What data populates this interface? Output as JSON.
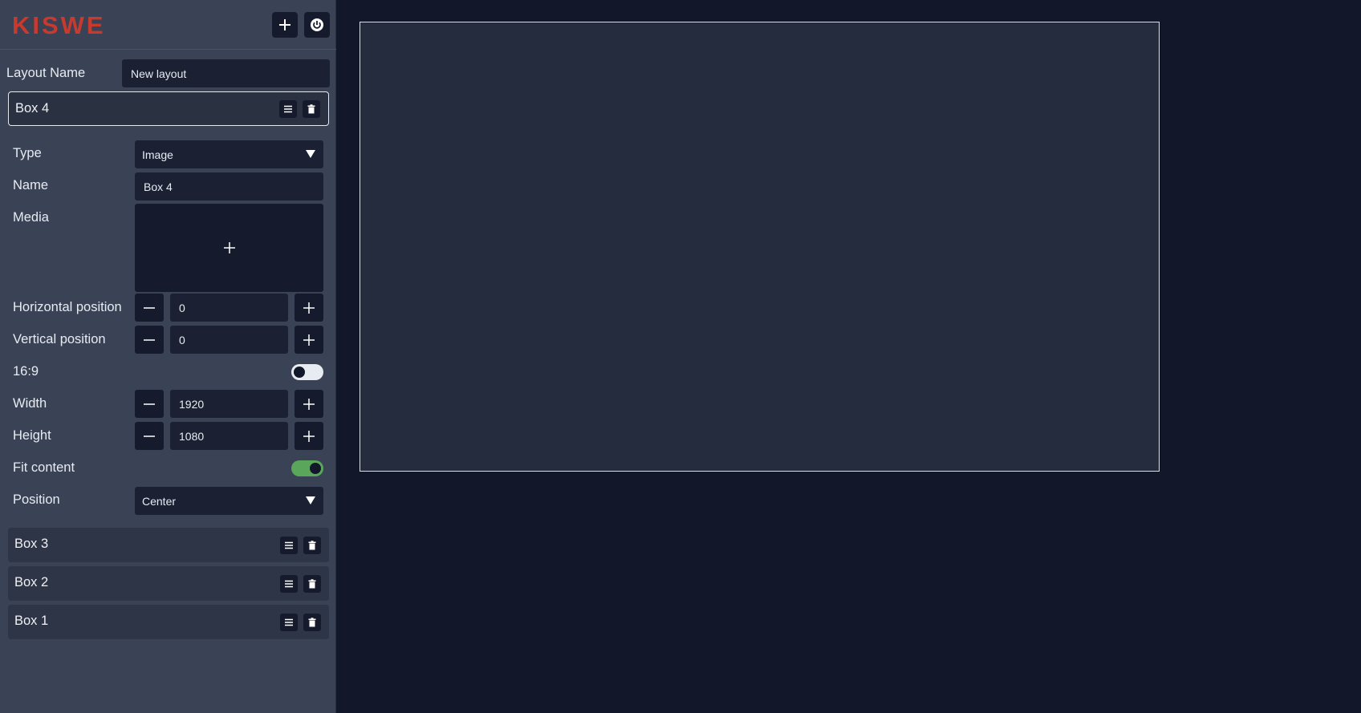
{
  "header": {
    "logo_text": "KISWE",
    "add_icon": "plus-icon",
    "power_icon": "power-icon"
  },
  "layout": {
    "name_label": "Layout Name",
    "name_value": "New layout"
  },
  "active_box": {
    "title": "Box 4",
    "fields": {
      "type_label": "Type",
      "type_value": "Image",
      "name_label": "Name",
      "name_value": "Box 4",
      "media_label": "Media",
      "hpos_label": "Horizontal position",
      "hpos_value": "0",
      "vpos_label": "Vertical position",
      "vpos_value": "0",
      "aspect_label": "16:9",
      "aspect_on": false,
      "width_label": "Width",
      "width_value": "1920",
      "height_label": "Height",
      "height_value": "1080",
      "fit_label": "Fit content",
      "fit_on": true,
      "position_label": "Position",
      "position_value": "Center"
    }
  },
  "boxes": [
    {
      "title": "Box 3"
    },
    {
      "title": "Box 2"
    },
    {
      "title": "Box 1"
    }
  ],
  "colors": {
    "accent_logo": "#c8392e",
    "toggle_on": "#5aa65a"
  }
}
